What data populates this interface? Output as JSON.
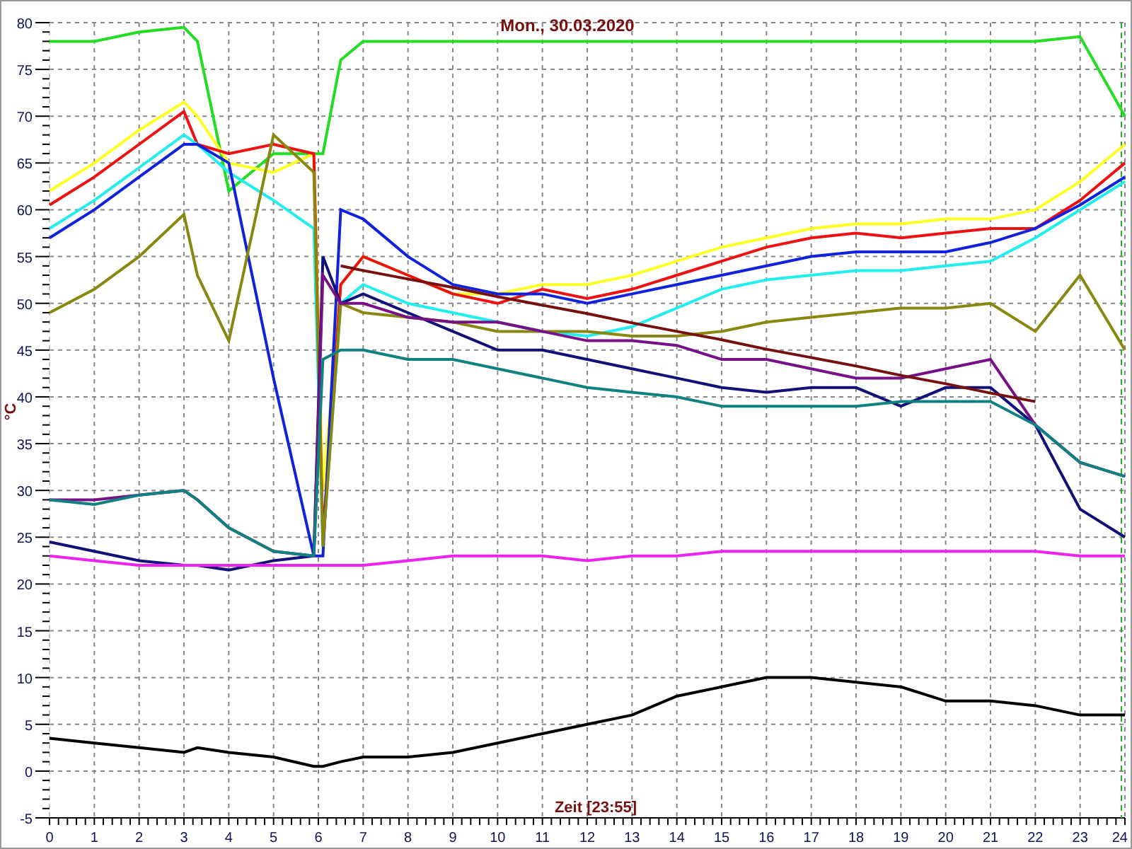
{
  "chart_data": {
    "type": "line",
    "title": "Mon., 30.03.2020",
    "xlabel": "Zeit [23:55]",
    "ylabel": "°C",
    "x": [
      0,
      1,
      2,
      3,
      3.3,
      4,
      5,
      5.9,
      6.1,
      6.5,
      7,
      8,
      9,
      10,
      11,
      12,
      13,
      14,
      15,
      16,
      17,
      18,
      19,
      20,
      21,
      22,
      23,
      24
    ],
    "xlim": [
      0,
      24
    ],
    "ylim": [
      -5,
      80
    ],
    "grid": true,
    "ref_lines": [
      {
        "axis": "x",
        "value": 23.92,
        "color": "#22aa22"
      }
    ],
    "xticks": [
      0,
      1,
      2,
      3,
      4,
      5,
      6,
      7,
      8,
      9,
      10,
      11,
      12,
      13,
      14,
      15,
      16,
      17,
      18,
      19,
      20,
      21,
      22,
      23,
      24
    ],
    "yticks": [
      -5,
      0,
      5,
      10,
      15,
      20,
      25,
      30,
      35,
      40,
      45,
      50,
      55,
      60,
      65,
      70,
      75,
      80
    ],
    "series": [
      {
        "color": "#22dd22",
        "values": [
          78,
          78,
          79,
          79.5,
          78,
          62,
          66,
          66,
          66,
          76,
          78,
          78,
          78,
          78,
          78,
          78,
          78,
          78,
          78,
          78,
          78,
          78,
          78,
          78,
          78,
          78,
          78.5,
          70
        ]
      },
      {
        "color": "#ffff22",
        "values": [
          62,
          65,
          68.5,
          71.5,
          70,
          65,
          64,
          66,
          30,
          52,
          55,
          53,
          51,
          51,
          52,
          52,
          53,
          54.5,
          56,
          57,
          58,
          58.5,
          58.5,
          59,
          59,
          60,
          63,
          67
        ]
      },
      {
        "color": "#ee1111",
        "values": [
          60.5,
          63.5,
          67,
          70.5,
          67,
          66,
          67,
          66,
          25,
          52,
          55,
          53,
          51,
          50,
          51.5,
          50.5,
          51.5,
          53,
          54.5,
          56,
          57,
          57.5,
          57,
          57.5,
          58,
          58,
          61,
          65
        ]
      },
      {
        "color": "#22eeee",
        "values": [
          58,
          61,
          64.5,
          68,
          67,
          64,
          61,
          58,
          24,
          50,
          52,
          50,
          49,
          48,
          47,
          46.5,
          47.5,
          49.5,
          51.5,
          52.5,
          53,
          53.5,
          53.5,
          54,
          54.5,
          57,
          60,
          63
        ]
      },
      {
        "color": "#1122dd",
        "values": [
          57,
          60,
          63.5,
          67,
          67,
          65,
          42,
          23,
          23,
          60,
          59,
          55,
          52,
          51,
          51,
          50,
          51,
          52,
          53,
          54,
          55,
          55.5,
          55.5,
          55.5,
          56.5,
          58,
          60.5,
          63.5
        ]
      },
      {
        "color": "#888811",
        "values": [
          49,
          51.5,
          55,
          59.5,
          53,
          46,
          68,
          64,
          24,
          50,
          49,
          48.5,
          48,
          47,
          47,
          47,
          46.5,
          46.5,
          47,
          48,
          48.5,
          49,
          49.5,
          49.5,
          50,
          47,
          53,
          45
        ]
      },
      {
        "color": "#111177",
        "values": [
          24.5,
          23.5,
          22.5,
          22,
          22,
          21.5,
          22.5,
          23,
          55,
          50,
          51,
          49,
          47,
          45,
          45,
          44,
          43,
          42,
          41,
          40.5,
          41,
          41,
          39,
          41,
          41,
          37,
          28,
          25
        ]
      },
      {
        "color": "#771188",
        "values": [
          29,
          29,
          29.5,
          30,
          29,
          26,
          23.5,
          23,
          53,
          50,
          50,
          48.5,
          48,
          48,
          47,
          46,
          46,
          45.5,
          44,
          44,
          43,
          42,
          42,
          43,
          44,
          37,
          33,
          31.5
        ]
      },
      {
        "color": "#118080",
        "values": [
          29,
          28.5,
          29.5,
          30,
          29,
          26,
          23.5,
          23,
          44,
          45,
          45,
          44,
          44,
          43,
          42,
          41,
          40.5,
          40,
          39,
          39,
          39,
          39,
          39.5,
          39.5,
          39.5,
          37,
          33,
          31.5
        ]
      },
      {
        "color": "#ee22ee",
        "values": [
          23,
          22.5,
          22,
          22,
          22,
          22,
          22,
          22,
          22,
          22,
          22,
          22.5,
          23,
          23,
          23,
          22.5,
          23,
          23,
          23.5,
          23.5,
          23.5,
          23.5,
          23.5,
          23.5,
          23.5,
          23.5,
          23,
          23
        ]
      },
      {
        "color": "#771111",
        "values": [
          null,
          null,
          null,
          null,
          null,
          null,
          null,
          null,
          null,
          54,
          53.5,
          52.6,
          51.7,
          50.7,
          49.8,
          48.9,
          47.9,
          47,
          46.1,
          45.1,
          44.2,
          43.3,
          42.3,
          41.4,
          40.4,
          39.5,
          null,
          null
        ]
      },
      {
        "color": "#000000",
        "values": [
          3.5,
          3,
          2.5,
          2,
          2.5,
          2,
          1.5,
          0.5,
          0.5,
          1,
          1.5,
          1.5,
          2,
          3,
          4,
          5,
          6,
          8,
          9,
          10,
          10,
          9.5,
          9,
          7.5,
          7.5,
          7,
          6,
          6
        ]
      }
    ]
  }
}
